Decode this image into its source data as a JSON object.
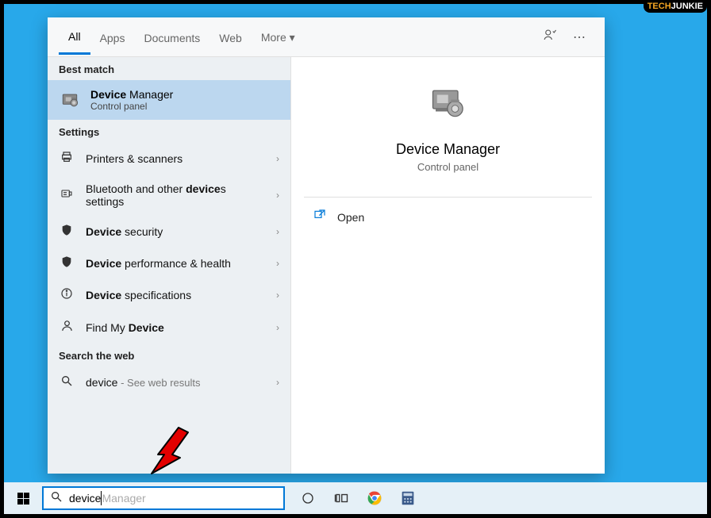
{
  "logo": {
    "prefix": "TECH",
    "suffix": "JUNKIE"
  },
  "tabs": [
    "All",
    "Apps",
    "Documents",
    "Web",
    "More"
  ],
  "active_tab": 0,
  "sections": {
    "best_match_header": "Best match",
    "best_match": {
      "title_bold": "Device",
      "title_rest": " Manager",
      "subtitle": "Control panel"
    },
    "settings_header": "Settings",
    "settings_items": [
      {
        "icon": "printer",
        "pre": "",
        "bold": "",
        "text": "Printers & scanners"
      },
      {
        "icon": "bluetooth",
        "pre": "Bluetooth and other ",
        "bold": "device",
        "text": "s settings"
      },
      {
        "icon": "shield",
        "pre": "",
        "bold": "Device",
        "text": " security"
      },
      {
        "icon": "shield",
        "pre": "",
        "bold": "Device",
        "text": " performance & health"
      },
      {
        "icon": "info",
        "pre": "",
        "bold": "Device",
        "text": " specifications"
      },
      {
        "icon": "person",
        "pre": "Find My ",
        "bold": "Device",
        "text": ""
      }
    ],
    "web_header": "Search the web",
    "web_item": {
      "term": "device",
      "aux": " - See web results"
    }
  },
  "detail": {
    "title": "Device Manager",
    "subtitle": "Control panel",
    "actions": [
      {
        "icon": "open",
        "label": "Open"
      }
    ]
  },
  "search": {
    "typed": "device",
    "suggestion": " Manager"
  }
}
